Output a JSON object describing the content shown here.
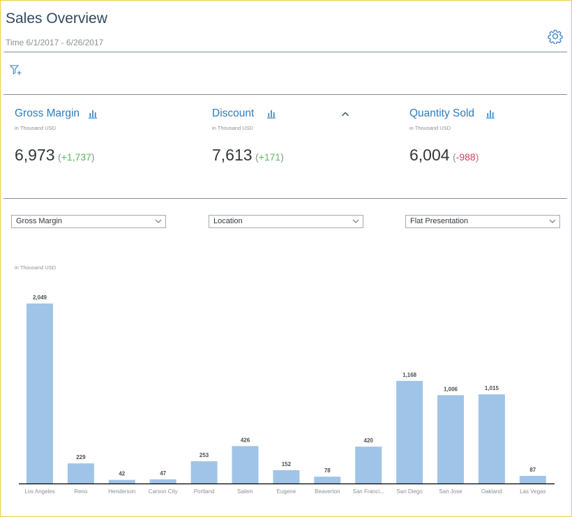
{
  "header": {
    "title": "Sales Overview",
    "subtitle": "Time 6/1/2017 - 6/26/2017"
  },
  "icons": {
    "settings": "gear-icon",
    "filter": "filter-add-icon",
    "chart": "bar-chart-icon",
    "collapse": "chevron-up-icon",
    "dropdown": "chevron-down-icon"
  },
  "colors": {
    "title": "#32475c",
    "accent": "#2b7cc4",
    "positive": "#5cb85c",
    "negative": "#e0385f",
    "bar": "#a0c4e8"
  },
  "kpis": [
    {
      "title": "Gross Margin",
      "unit": "in Thousand USD",
      "value": "6,973",
      "delta": "+1,737",
      "trend": "positive"
    },
    {
      "title": "Discount",
      "unit": "in Thousand USD",
      "value": "7,613",
      "delta": "+171",
      "trend": "positive"
    },
    {
      "title": "Quantity Sold",
      "unit": "in Thousand USD",
      "value": "6,004",
      "delta": "-988",
      "trend": "negative"
    }
  ],
  "selects": {
    "measure": "Gross Margin",
    "dimension": "Location",
    "presentation": "Flat Presentation"
  },
  "chart": {
    "unit_label": "in Thousand USD"
  },
  "chart_data": {
    "type": "bar",
    "categories": [
      "Los Angeles",
      "Reno",
      "Henderson",
      "Carson City",
      "Portland",
      "Salem",
      "Eugene",
      "Beaverton",
      "San Franci...",
      "San Diego",
      "San Jose",
      "Oakland",
      "Las Vegas"
    ],
    "values": [
      2049,
      229,
      42,
      47,
      253,
      426,
      152,
      78,
      420,
      1168,
      1006,
      1015,
      87
    ],
    "data_labels": [
      "2,049",
      "229",
      "42",
      "47",
      "253",
      "426",
      "152",
      "78",
      "420",
      "1,168",
      "1,006",
      "1,015",
      "87"
    ],
    "ylabel": "in Thousand USD",
    "grid": false,
    "legend": "none"
  }
}
